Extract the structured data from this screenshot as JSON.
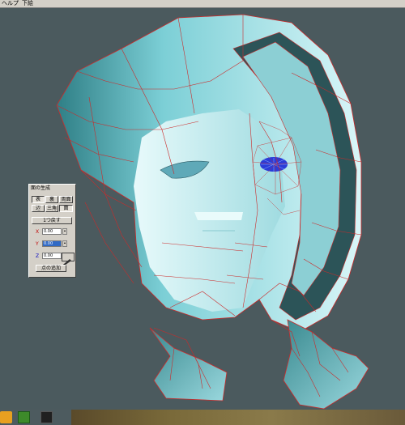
{
  "menubar": {
    "item_1": "ヘルプ",
    "item_2": "下絵"
  },
  "panel": {
    "title": "面の生成",
    "row1": {
      "front": "表",
      "back": "裏",
      "both": "両面"
    },
    "row2": {
      "edge": "辺",
      "triangle": "三角",
      "face": "面"
    },
    "undo": "1つ戻す",
    "x_label": "X",
    "x_value": "0.00",
    "y_label": "Y",
    "y_value": "0.00",
    "z_label": "Z",
    "z_value": "0.00",
    "add_point": "点の追加"
  },
  "colors": {
    "background": "#4b5a5e",
    "mesh_fill": "#bfeef2",
    "wire": "#cc2a2a",
    "eye": "#2a3cd8",
    "selection": "#316ac5"
  }
}
